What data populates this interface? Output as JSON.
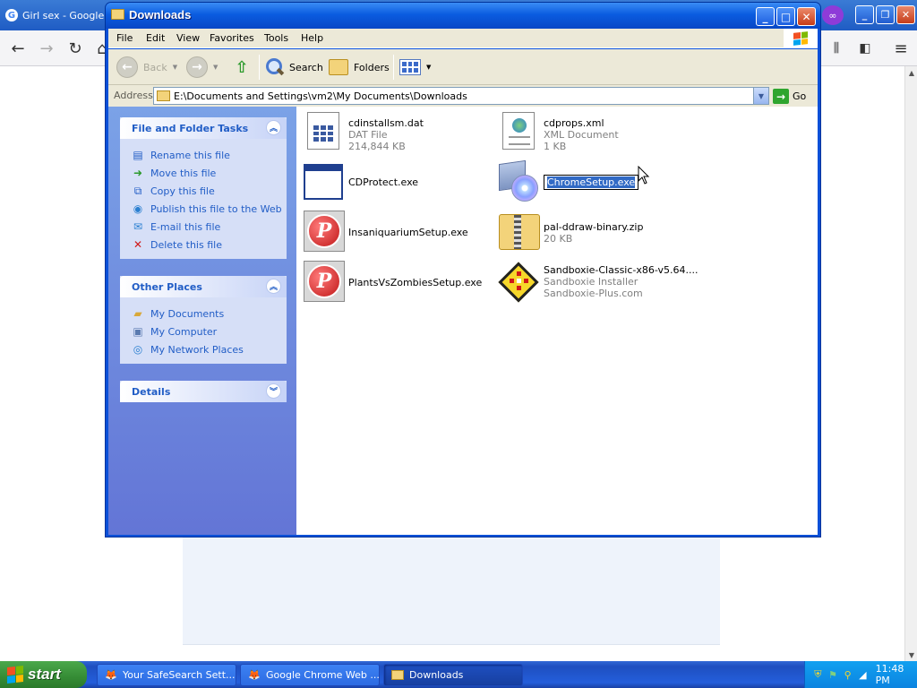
{
  "browser": {
    "tab_title": "Girl sex - Google S",
    "nav": {
      "back_icon": "back-arrow-icon",
      "forward_icon": "forward-arrow-icon",
      "reload_icon": "reload-icon"
    }
  },
  "window": {
    "title": "Downloads",
    "menu": [
      "File",
      "Edit",
      "View",
      "Favorites",
      "Tools",
      "Help"
    ],
    "toolbar": {
      "back": "Back",
      "search": "Search",
      "folders": "Folders"
    },
    "address_label": "Address",
    "address": "E:\\Documents and Settings\\vm2\\My Documents\\Downloads",
    "go": "Go"
  },
  "tasks_panel": {
    "title": "File and Folder Tasks",
    "items": [
      {
        "label": "Rename this file",
        "icon": "rename-icon"
      },
      {
        "label": "Move this file",
        "icon": "move-icon"
      },
      {
        "label": "Copy this file",
        "icon": "copy-icon"
      },
      {
        "label": "Publish this file to the Web",
        "icon": "globe-icon"
      },
      {
        "label": "E-mail this file",
        "icon": "email-icon"
      },
      {
        "label": "Delete this file",
        "icon": "delete-icon"
      }
    ]
  },
  "places_panel": {
    "title": "Other Places",
    "items": [
      {
        "label": "My Documents",
        "icon": "folder-icon"
      },
      {
        "label": "My Computer",
        "icon": "computer-icon"
      },
      {
        "label": "My Network Places",
        "icon": "network-icon"
      }
    ]
  },
  "details_panel": {
    "title": "Details"
  },
  "files": [
    {
      "name": "cdinstallsm.dat",
      "type": "DAT File",
      "size": "214,844 KB",
      "icon": "dat-file-icon"
    },
    {
      "name": "cdprops.xml",
      "type": "XML Document",
      "size": "1 KB",
      "icon": "xml-file-icon"
    },
    {
      "name": "CDProtect.exe",
      "icon": "application-icon"
    },
    {
      "name": "ChromeSetup.exe",
      "icon": "setup-cd-icon",
      "renaming": true
    },
    {
      "name": "InsaniquariumSetup.exe",
      "icon": "popcap-icon"
    },
    {
      "name": "pal-ddraw-binary.zip",
      "size": "20 KB",
      "icon": "zip-folder-icon"
    },
    {
      "name": "PlantsVsZombiesSetup.exe",
      "icon": "popcap-icon"
    },
    {
      "name": "Sandboxie-Classic-x86-v5.64....",
      "type": "Sandboxie Installer",
      "company": "Sandboxie-Plus.com",
      "icon": "sandboxie-icon"
    }
  ],
  "taskbar": {
    "start": "start",
    "buttons": [
      {
        "label": "Your SafeSearch Sett...",
        "icon": "firefox-icon"
      },
      {
        "label": "Google Chrome Web ...",
        "icon": "firefox-icon"
      },
      {
        "label": "Downloads",
        "icon": "folder-icon",
        "active": true
      }
    ],
    "clock": "11:48 PM"
  }
}
